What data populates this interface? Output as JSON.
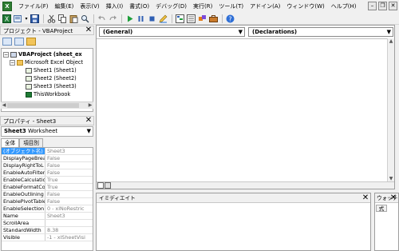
{
  "menu": {
    "items": [
      "ファイル(F)",
      "編集(E)",
      "表示(V)",
      "挿入(I)",
      "書式(O)",
      "デバッグ(D)",
      "実行(R)",
      "ツール(T)",
      "アドイン(A)",
      "ウィンドウ(W)",
      "ヘルプ(H)"
    ],
    "win_min": "–",
    "win_restore": "❐",
    "win_close": "✕"
  },
  "project_panel": {
    "title": "プロジェクト - VBAProject",
    "close": "✕",
    "tree": [
      {
        "label": "VBAProject (sheet_ex",
        "kind": "proj",
        "bold": true
      },
      {
        "label": "Microsoft Excel Object",
        "kind": "folder",
        "bold": false
      },
      {
        "label": "Sheet1 (Sheet1)",
        "kind": "sheet",
        "bold": false
      },
      {
        "label": "Sheet2 (Sheet2)",
        "kind": "sheet",
        "bold": false
      },
      {
        "label": "Sheet3 (Sheet3)",
        "kind": "sheet",
        "bold": false
      },
      {
        "label": "ThisWorkbook",
        "kind": "wb",
        "bold": false
      }
    ],
    "expand_sign": "−"
  },
  "properties_panel": {
    "title": "プロパティ - Sheet3",
    "close": "✕",
    "object_name": "Sheet3",
    "object_type": "Worksheet",
    "tabs": [
      "全体",
      "項目別"
    ],
    "rows": [
      {
        "key": "(オブジェクト名)",
        "value": "Sheet3"
      },
      {
        "key": "DisplayPageBrea",
        "value": "False"
      },
      {
        "key": "DisplayRightToL",
        "value": "False"
      },
      {
        "key": "EnableAutoFilter",
        "value": "False"
      },
      {
        "key": "EnableCalculatio",
        "value": "True"
      },
      {
        "key": "EnableFormatCo",
        "value": "True"
      },
      {
        "key": "EnableOutlining",
        "value": "False"
      },
      {
        "key": "EnablePivotTable",
        "value": "False"
      },
      {
        "key": "EnableSelection",
        "value": "0 - xlNoRestric"
      },
      {
        "key": "Name",
        "value": "Sheet3"
      },
      {
        "key": "ScrollArea",
        "value": ""
      },
      {
        "key": "StandardWidth",
        "value": "8.38"
      },
      {
        "key": "Visible",
        "value": "-1 - xlSheetVisi"
      }
    ]
  },
  "code_window": {
    "object_combo": "(General)",
    "proc_combo": "(Declarations)"
  },
  "immediate": {
    "title": "イミディエイト",
    "close": "✕"
  },
  "watch": {
    "title": "ウォッチ",
    "close": "✕",
    "column": "式"
  },
  "toolbar": {
    "icons": [
      "excel-icon",
      "insert-module-icon",
      "save-icon",
      "cut-icon",
      "copy-icon",
      "paste-icon",
      "find-icon",
      "undo-icon",
      "redo-icon",
      "run-icon",
      "break-icon",
      "reset-icon",
      "design-mode-icon",
      "project-explorer-icon",
      "properties-icon",
      "object-browser-icon",
      "toolbox-icon",
      "help-icon"
    ]
  }
}
